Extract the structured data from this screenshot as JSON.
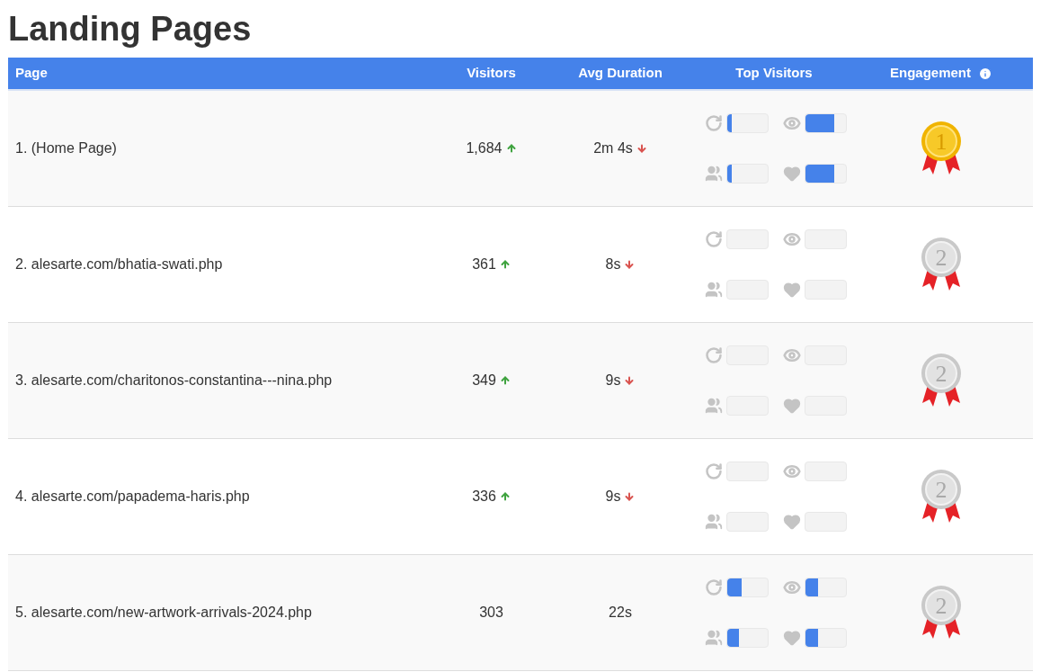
{
  "title": "Landing Pages",
  "columns": [
    "Page",
    "Visitors",
    "Avg Duration",
    "Top Visitors",
    "Engagement"
  ],
  "rows": [
    {
      "page": "1. (Home Page)",
      "visitors": "1,684",
      "visitors_up": true,
      "duration": "2m 4s",
      "duration_down": true,
      "meters": [
        {
          "kind": "returning",
          "level": 0.1
        },
        {
          "kind": "views",
          "level": 0.72
        },
        {
          "kind": "group",
          "level": 0.1
        },
        {
          "kind": "likes",
          "level": 0.72
        }
      ],
      "medal": {
        "kind": "gold",
        "label": "1"
      }
    },
    {
      "page": "2. alesarte.com/bhatia-swati.php",
      "visitors": "361",
      "visitors_up": true,
      "duration": "8s",
      "duration_down": true,
      "meters": [
        {
          "kind": "returning",
          "level": 0
        },
        {
          "kind": "views",
          "level": 0
        },
        {
          "kind": "group",
          "level": 0
        },
        {
          "kind": "likes",
          "level": 0
        }
      ],
      "medal": {
        "kind": "silver",
        "label": "2"
      }
    },
    {
      "page": "3. alesarte.com/charitonos-constantina---nina.php",
      "visitors": "349",
      "visitors_up": true,
      "duration": "9s",
      "duration_down": true,
      "meters": [
        {
          "kind": "returning",
          "level": 0
        },
        {
          "kind": "views",
          "level": 0
        },
        {
          "kind": "group",
          "level": 0
        },
        {
          "kind": "likes",
          "level": 0
        }
      ],
      "medal": {
        "kind": "silver",
        "label": "2"
      }
    },
    {
      "page": "4. alesarte.com/papadema-haris.php",
      "visitors": "336",
      "visitors_up": true,
      "duration": "9s",
      "duration_down": true,
      "meters": [
        {
          "kind": "returning",
          "level": 0
        },
        {
          "kind": "views",
          "level": 0
        },
        {
          "kind": "group",
          "level": 0
        },
        {
          "kind": "likes",
          "level": 0
        }
      ],
      "medal": {
        "kind": "silver",
        "label": "2"
      }
    },
    {
      "page": "5. alesarte.com/new-artwork-arrivals-2024.php",
      "visitors": "303",
      "visitors_up": false,
      "duration": "22s",
      "duration_down": false,
      "meters": [
        {
          "kind": "returning",
          "level": 0.35
        },
        {
          "kind": "views",
          "level": 0.3
        },
        {
          "kind": "group",
          "level": 0.28
        },
        {
          "kind": "likes",
          "level": 0.3
        }
      ],
      "medal": {
        "kind": "silver",
        "label": "2"
      }
    }
  ]
}
